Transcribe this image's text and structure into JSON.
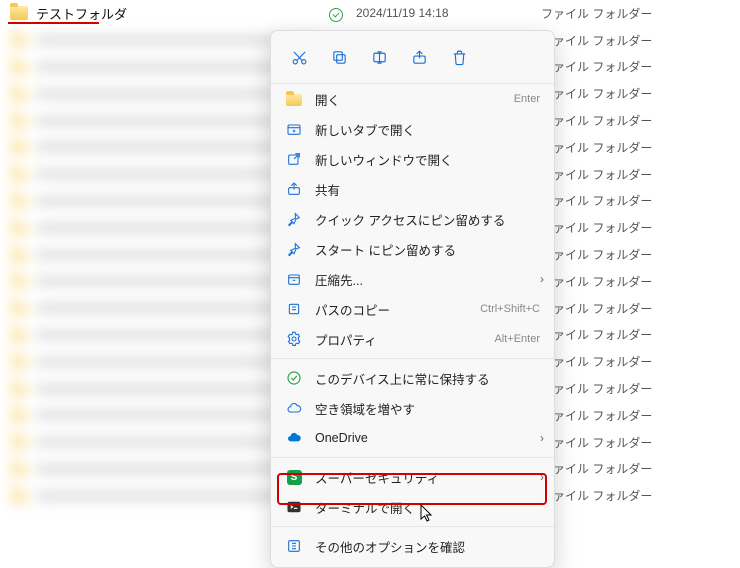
{
  "selected_row": {
    "name": "テストフォルダ",
    "date": "2024/11/19 14:18",
    "type": "ファイル フォルダー"
  },
  "other_rows_type": "ファイル フォルダー",
  "row_count_below": 18,
  "menu": {
    "open": {
      "label": "開く",
      "shortcut": "Enter"
    },
    "new_tab": {
      "label": "新しいタブで開く"
    },
    "new_window": {
      "label": "新しいウィンドウで開く"
    },
    "share": {
      "label": "共有"
    },
    "pin_quick": {
      "label": "クイック アクセスにピン留めする"
    },
    "pin_start": {
      "label": "スタート にピン留めする"
    },
    "compress": {
      "label": "圧縮先..."
    },
    "copy_path": {
      "label": "パスのコピー",
      "shortcut": "Ctrl+Shift+C"
    },
    "properties": {
      "label": "プロパティ",
      "shortcut": "Alt+Enter"
    },
    "always_keep": {
      "label": "このデバイス上に常に保持する"
    },
    "free_space": {
      "label": "空き領域を増やす"
    },
    "onedrive": {
      "label": "OneDrive"
    },
    "super_security": {
      "label": "スーパーセキュリティ"
    },
    "terminal": {
      "label": "ターミナルで開く"
    },
    "more_options": {
      "label": "その他のオプションを確認"
    }
  },
  "colors": {
    "accent": "#1a6fd6",
    "highlight": "#d40000",
    "green": "#2da44e"
  }
}
